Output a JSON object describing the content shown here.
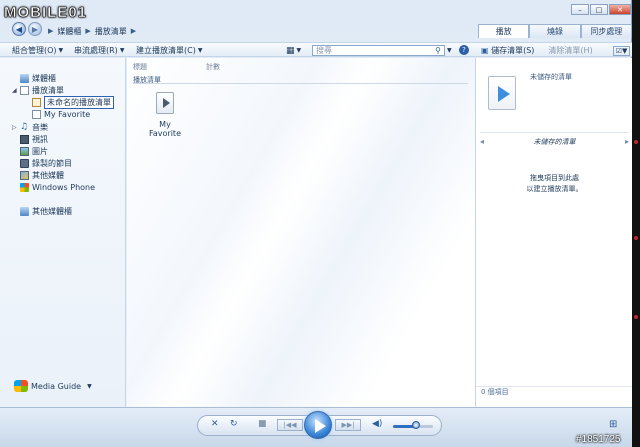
{
  "logo": {
    "text": "MOBILE01"
  },
  "breadcrumb": {
    "items": [
      "媒體櫃",
      "播放清單"
    ]
  },
  "tabs": [
    {
      "label": "播放"
    },
    {
      "label": "燒錄"
    },
    {
      "label": "同步處理"
    }
  ],
  "toolbar": {
    "organize": "組合管理(O)",
    "stream": "串流處理(R)",
    "create_playlist": "建立播放清單(C)",
    "search_placeholder": "搜尋"
  },
  "nav": {
    "library": "媒體櫃",
    "playlists": "播放清單",
    "rename_value": "未命名的播放清單",
    "my_favorite": "My Favorite",
    "music": "音樂",
    "videos": "視訊",
    "pictures": "圖片",
    "recorded_tv": "錄製的節目",
    "other_media": "其他媒體",
    "windows_phone": "Windows Phone",
    "other_libraries": "其他媒體櫃",
    "media_guide": "Media Guide"
  },
  "main": {
    "col_title": "標題",
    "col_count": "計數",
    "group_header": "播放清單",
    "tile_label": "My Favorite"
  },
  "right_pane": {
    "save_list": "儲存清單(S)",
    "clear_list": "清除清單(H)",
    "unsaved_top": "未儲存的清單",
    "unsaved_title": "未儲存的清單",
    "hint_line1": "拖曳項目到此處",
    "hint_line2": "以建立播放清單。",
    "item_count": "0 個項目"
  },
  "watermark": "#1851725",
  "colors": {
    "accent": "#3a86d8",
    "text": "#1e395b",
    "panel": "#eaf1f9"
  }
}
